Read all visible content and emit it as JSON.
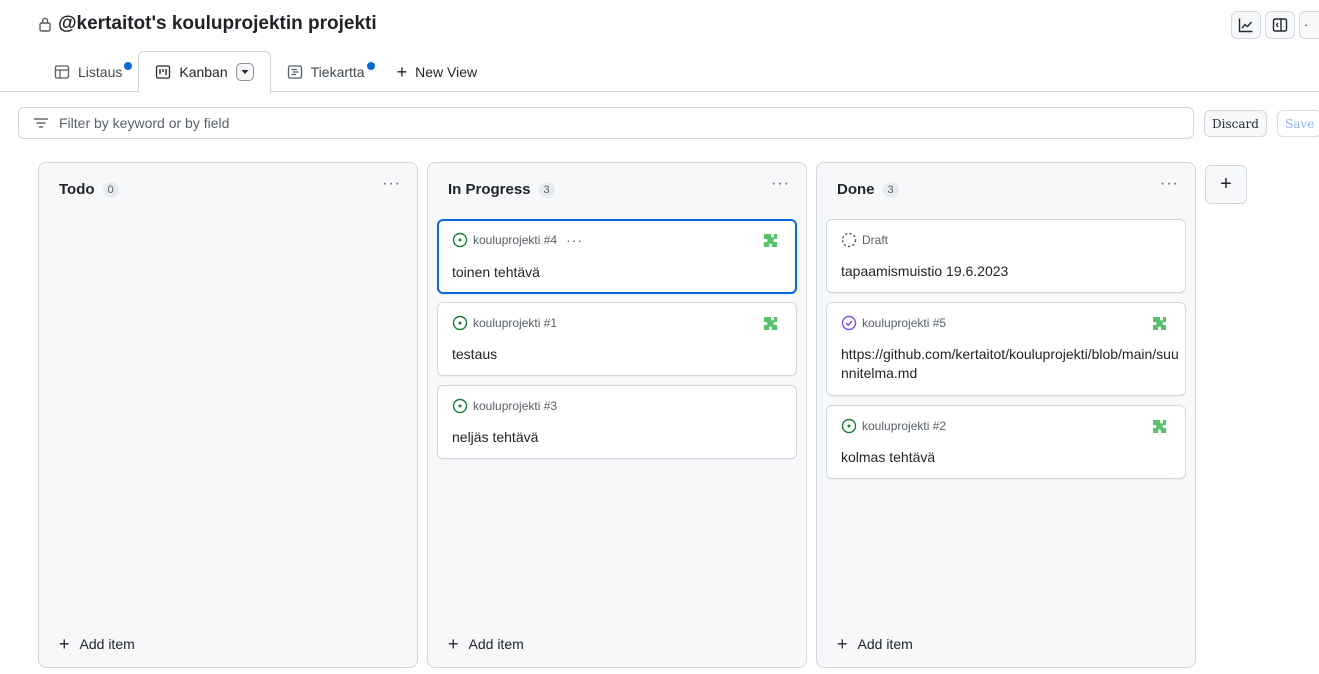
{
  "header": {
    "title": "@kertaitot's kouluprojektin projekti"
  },
  "tabs": [
    {
      "label": "Listaus",
      "icon": "table-icon",
      "unsaved": true
    },
    {
      "label": "Kanban",
      "icon": "board-icon",
      "active": true
    },
    {
      "label": "Tiekartta",
      "icon": "roadmap-icon",
      "unsaved": true
    },
    {
      "label": "New View",
      "icon": "plus-icon"
    }
  ],
  "filter": {
    "placeholder": "Filter by keyword or by field",
    "discard_label": "Discard",
    "save_label": "Save"
  },
  "columns": [
    {
      "title": "Todo",
      "count": "0",
      "add_label": "Add item",
      "cards": []
    },
    {
      "title": "In Progress",
      "count": "3",
      "add_label": "Add item",
      "cards": [
        {
          "meta": "kouluprojekti #4",
          "title": "toinen tehtävä",
          "status": "open",
          "selected": true
        },
        {
          "meta": "kouluprojekti #1",
          "title": "testaus",
          "status": "open"
        },
        {
          "meta": "kouluprojekti #3",
          "title": "neljäs tehtävä",
          "status": "open"
        }
      ]
    },
    {
      "title": "Done",
      "count": "3",
      "add_label": "Add item",
      "cards": [
        {
          "meta": "Draft",
          "title": "tapaamismuistio 19.6.2023",
          "status": "draft"
        },
        {
          "meta": "kouluprojekti #5",
          "title": "https://github.com/kertaitot/kouluprojekti/blob/main/suunnitelma.md",
          "status": "closed"
        },
        {
          "meta": "kouluprojekti #2",
          "title": "kolmas tehtävä",
          "status": "open"
        }
      ]
    }
  ],
  "colors": {
    "accent": "#0969da",
    "open": "#1a7f37",
    "closed": "#8250df",
    "puzzle": "#57c26b"
  }
}
